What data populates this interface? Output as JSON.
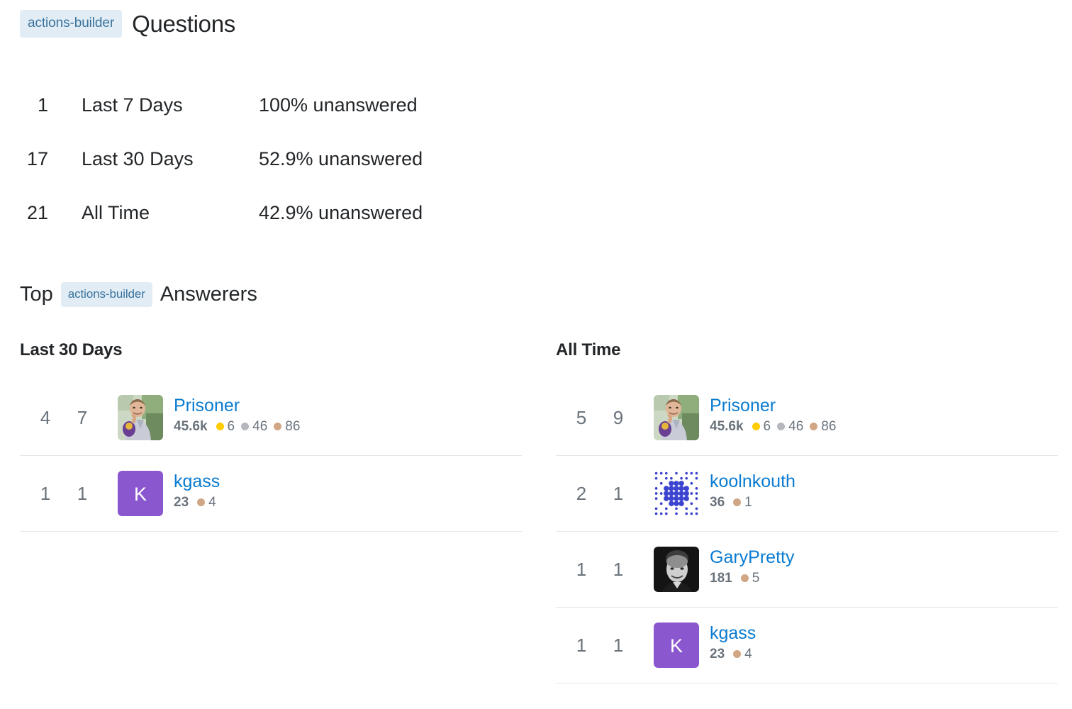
{
  "questions_section": {
    "tag": "actions-builder",
    "title": "Questions",
    "rows": [
      {
        "count": "1",
        "label": "Last 7 Days",
        "unanswered": "100% unanswered"
      },
      {
        "count": "17",
        "label": "Last 30 Days",
        "unanswered": "52.9% unanswered"
      },
      {
        "count": "21",
        "label": "All Time",
        "unanswered": "42.9% unanswered"
      }
    ]
  },
  "answerers_section": {
    "title_prefix": "Top",
    "tag": "actions-builder",
    "title_suffix": "Answerers",
    "columns": [
      {
        "heading": "Last 30 Days",
        "users": [
          {
            "score": "4",
            "answers": "7",
            "name": "Prisoner",
            "reputation": "45.6k",
            "avatar_type": "photo-prisoner",
            "avatar_letter": "",
            "badges": [
              {
                "type": "gold",
                "count": "6"
              },
              {
                "type": "silver",
                "count": "46"
              },
              {
                "type": "bronze",
                "count": "86"
              }
            ]
          },
          {
            "score": "1",
            "answers": "1",
            "name": "kgass",
            "reputation": "23",
            "avatar_type": "letter-purple",
            "avatar_letter": "K",
            "badges": [
              {
                "type": "bronze",
                "count": "4"
              }
            ]
          }
        ]
      },
      {
        "heading": "All Time",
        "users": [
          {
            "score": "5",
            "answers": "9",
            "name": "Prisoner",
            "reputation": "45.6k",
            "avatar_type": "photo-prisoner",
            "avatar_letter": "",
            "badges": [
              {
                "type": "gold",
                "count": "6"
              },
              {
                "type": "silver",
                "count": "46"
              },
              {
                "type": "bronze",
                "count": "86"
              }
            ]
          },
          {
            "score": "2",
            "answers": "1",
            "name": "koolnkouth",
            "reputation": "36",
            "avatar_type": "identicon-blue",
            "avatar_letter": "",
            "badges": [
              {
                "type": "bronze",
                "count": "1"
              }
            ]
          },
          {
            "score": "1",
            "answers": "1",
            "name": "GaryPretty",
            "reputation": "181",
            "avatar_type": "photo-bw-portrait",
            "avatar_letter": "",
            "badges": [
              {
                "type": "bronze",
                "count": "5"
              }
            ]
          },
          {
            "score": "1",
            "answers": "1",
            "name": "kgass",
            "reputation": "23",
            "avatar_type": "letter-purple",
            "avatar_letter": "K",
            "badges": [
              {
                "type": "bronze",
                "count": "4"
              }
            ]
          }
        ]
      }
    ]
  },
  "colors": {
    "tag_background": "#e1ecf4",
    "tag_text": "#39739d",
    "link": "#0a7bd1",
    "muted_text": "#6a737c",
    "badge_gold": "#ffcc01",
    "badge_silver": "#b4b8bc",
    "badge_bronze": "#d1a684",
    "avatar_purple": "#8a57cf",
    "divider": "#e4e6e8"
  }
}
